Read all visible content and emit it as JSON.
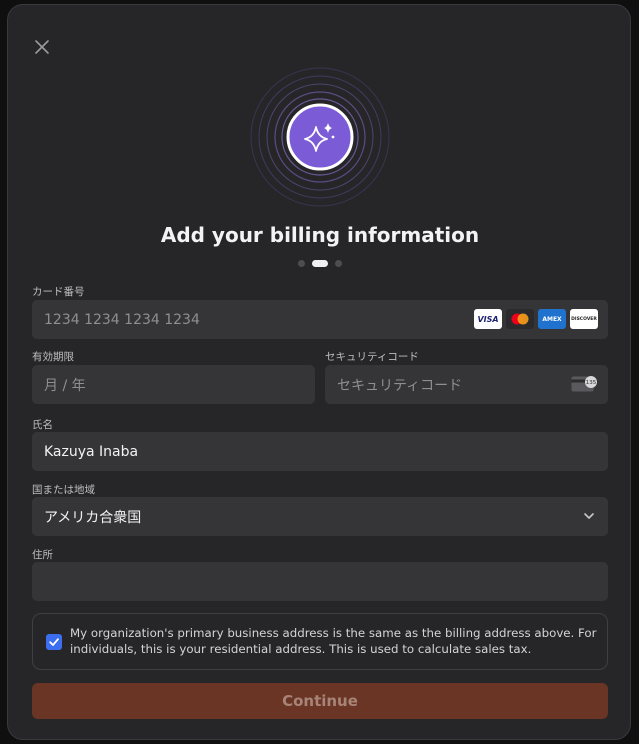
{
  "modal": {
    "title": "Add your billing information",
    "close_icon": "close-icon",
    "hero_icon": "sparkles-icon",
    "steps": {
      "count": 3,
      "active": 2
    }
  },
  "form": {
    "card_number": {
      "label": "カード番号",
      "placeholder": "1234 1234 1234 1234",
      "brands": [
        "VISA",
        "MC",
        "AMEX",
        "DISCOVER"
      ]
    },
    "expiry": {
      "label": "有効期限",
      "placeholder": "月 / 年"
    },
    "security_code": {
      "label": "セキュリティコード",
      "placeholder": "セキュリティコード",
      "badge": "135"
    },
    "name": {
      "label": "氏名",
      "value": "Kazuya Inaba"
    },
    "country": {
      "label": "国または地域",
      "value": "アメリカ合衆国"
    },
    "address": {
      "label": "住所",
      "value": ""
    },
    "same_address": {
      "checked": true,
      "text": "My organization's primary business address is the same as the billing address above. For individuals, this is your residential address. This is used to calculate sales tax."
    },
    "submit_label": "Continue"
  },
  "colors": {
    "accent_purple": "#7b5bd6",
    "checkbox_blue": "#3b6ff0",
    "button_bg": "#6b3526",
    "button_text": "#a68578"
  }
}
